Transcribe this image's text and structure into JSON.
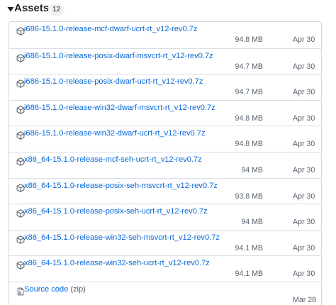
{
  "assets": {
    "title": "Assets",
    "count": "12",
    "items": [
      {
        "name": "i686-15.1.0-release-mcf-dwarf-ucrt-rt_v12-rev0.7z",
        "size": "94.8 MB",
        "date": "Apr 30",
        "icon": "package-icon"
      },
      {
        "name": "i686-15.1.0-release-posix-dwarf-msvcrt-rt_v12-rev0.7z",
        "size": "94.7 MB",
        "date": "Apr 30",
        "icon": "package-icon"
      },
      {
        "name": "i686-15.1.0-release-posix-dwarf-ucrt-rt_v12-rev0.7z",
        "size": "94.7 MB",
        "date": "Apr 30",
        "icon": "package-icon"
      },
      {
        "name": "i686-15.1.0-release-win32-dwarf-msvcrt-rt_v12-rev0.7z",
        "size": "94.8 MB",
        "date": "Apr 30",
        "icon": "package-icon"
      },
      {
        "name": "i686-15.1.0-release-win32-dwarf-ucrt-rt_v12-rev0.7z",
        "size": "94.8 MB",
        "date": "Apr 30",
        "icon": "package-icon"
      },
      {
        "name": "x86_64-15.1.0-release-mcf-seh-ucrt-rt_v12-rev0.7z",
        "size": "94 MB",
        "date": "Apr 30",
        "icon": "package-icon"
      },
      {
        "name": "x86_64-15.1.0-release-posix-seh-msvcrt-rt_v12-rev0.7z",
        "size": "93.8 MB",
        "date": "Apr 30",
        "icon": "package-icon"
      },
      {
        "name": "x86_64-15.1.0-release-posix-seh-ucrt-rt_v12-rev0.7z",
        "size": "94 MB",
        "date": "Apr 30",
        "icon": "package-icon"
      },
      {
        "name": "x86_64-15.1.0-release-win32-seh-msvcrt-rt_v12-rev0.7z",
        "size": "94.1 MB",
        "date": "Apr 30",
        "icon": "package-icon"
      },
      {
        "name": "x86_64-15.1.0-release-win32-seh-ucrt-rt_v12-rev0.7z",
        "size": "94.1 MB",
        "date": "Apr 30",
        "icon": "package-icon"
      }
    ],
    "source": {
      "label": "Source code",
      "format": "(zip)",
      "date": "Mar 28",
      "icon": "file-zip-icon"
    }
  }
}
